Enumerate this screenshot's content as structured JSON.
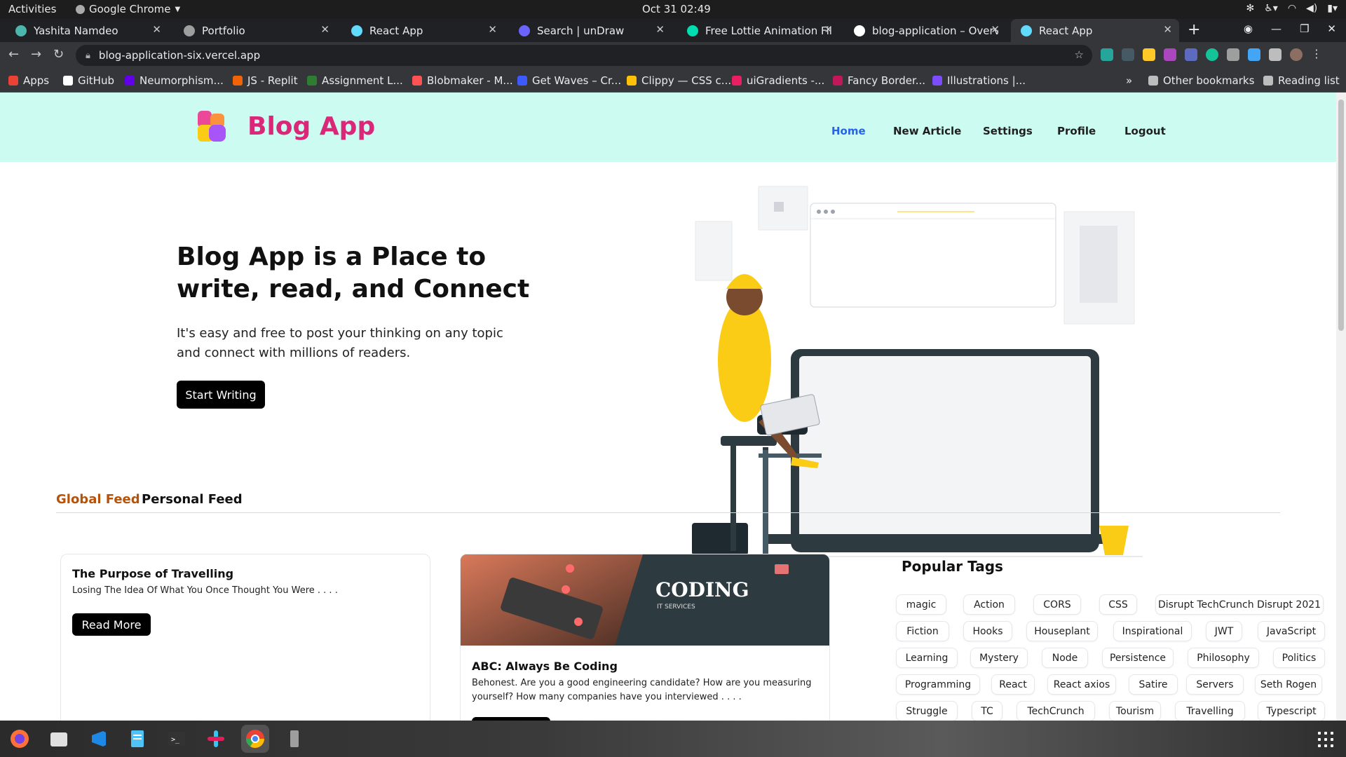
{
  "system": {
    "activities": "Activities",
    "app_name": "Google Chrome",
    "clock": "Oct 31  02:49"
  },
  "browser": {
    "tabs": [
      {
        "title": "Yashita Namdeo",
        "color": "#4db6ac"
      },
      {
        "title": "Portfolio",
        "color": "#9e9e9e"
      },
      {
        "title": "React App",
        "color": "#61dafb"
      },
      {
        "title": "Search | unDraw",
        "color": "#6c63ff"
      },
      {
        "title": "Free Lottie Animation File",
        "color": "#00ddb3"
      },
      {
        "title": "blog-application – Overvie",
        "color": "#ffffff"
      },
      {
        "title": "React App",
        "color": "#61dafb"
      }
    ],
    "url": "blog-application-six.vercel.app",
    "bookmarks": [
      {
        "label": "Apps",
        "color": "#ea4335"
      },
      {
        "label": "GitHub",
        "color": "#ffffff"
      },
      {
        "label": "Neumorphism...",
        "color": "#6200ea"
      },
      {
        "label": "JS - Replit",
        "color": "#f26207"
      },
      {
        "label": "Assignment L...",
        "color": "#2e7d32"
      },
      {
        "label": "Blobmaker - M...",
        "color": "#ff5252"
      },
      {
        "label": "Get Waves – Cr...",
        "color": "#3d5afe"
      },
      {
        "label": "Clippy — CSS c...",
        "color": "#ffc107"
      },
      {
        "label": "uiGradients -...",
        "color": "#e91e63"
      },
      {
        "label": "Fancy Border...",
        "color": "#c2185b"
      },
      {
        "label": "Illustrations |...",
        "color": "#7c4dff"
      }
    ],
    "other_bookmarks": "Other bookmarks",
    "reading_list": "Reading list"
  },
  "site": {
    "brand": "Blog App",
    "brand_color": "#db2777",
    "header_bg": "#ccfbf1",
    "nav": [
      "Home",
      "New Article",
      "Settings",
      "Profile",
      "Logout"
    ],
    "hero": {
      "title": "Blog App is a Place to write, read, and Connect",
      "subtitle": "It's easy and free to post your thinking on any topic and connect with millions of readers.",
      "cta": "Start Writing"
    },
    "feed_tabs": [
      "Global Feed",
      "Personal Feed"
    ],
    "active_tab_color": "#b45309",
    "cards": [
      {
        "title": "The Purpose of Travelling",
        "description": "Losing The Idea Of What You Once Thought You Were . . . .",
        "button": "Read More"
      },
      {
        "title": "ABC: Always Be Coding",
        "description": "Behonest. Are you a good engineering candidate? How are you measuring yourself? How many companies have you interviewed . . . .",
        "banner_heading": "CODING",
        "banner_sub": "IT SERVICES"
      }
    ],
    "popular_tags_title": "Popular Tags",
    "tags": [
      "magic",
      "Action",
      "CORS",
      "CSS",
      "Disrupt TechCrunch Disrupt 2021",
      "Fiction",
      "Hooks",
      "Houseplant",
      "Inspirational",
      "JWT",
      "JavaScript",
      "Learning",
      "Mystery",
      "Node",
      "Persistence",
      "Philosophy",
      "Politics",
      "Programming",
      "React",
      "React axios",
      "Satire",
      "Servers",
      "Seth Rogen",
      "Struggle",
      "TC",
      "TechCrunch",
      "Tourism",
      "Travelling",
      "Typescript"
    ]
  },
  "dock": [
    "firefox-icon",
    "files-icon",
    "vscode-icon",
    "text-editor-icon",
    "terminal-icon",
    "slack-icon",
    "chrome-icon",
    "device-icon"
  ]
}
